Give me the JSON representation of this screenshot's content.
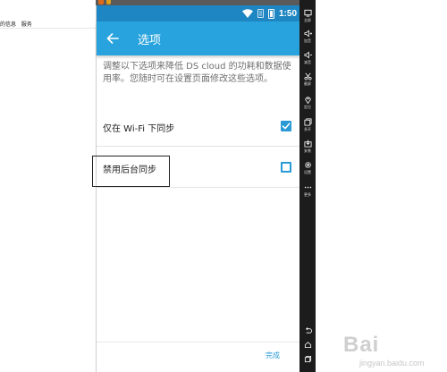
{
  "host": {
    "menu_items": [
      "的信息",
      "服务"
    ]
  },
  "status_bar": {
    "time": "1:50",
    "icons": [
      "wifi-icon",
      "sim-icon",
      "battery-icon"
    ]
  },
  "app_bar": {
    "title": "选项",
    "back_icon": "arrow-left-icon"
  },
  "description": "调整以下选项来降低 DS cloud 的功耗和数据使用率。您随时可在设置页面修改这些选项。",
  "options": [
    {
      "label": "仅在 Wi-Fi 下同步",
      "checked": true
    },
    {
      "label": "禁用后台同步",
      "checked": false
    }
  ],
  "footer": {
    "done_label": "完成"
  },
  "emulator_sidebar": {
    "items": [
      {
        "icon": "screen-icon",
        "label": "全屏"
      },
      {
        "icon": "volume-up-icon",
        "label": "加音"
      },
      {
        "icon": "volume-down-icon",
        "label": "减音"
      },
      {
        "icon": "scissors-icon",
        "label": "截屏"
      },
      {
        "icon": "location-icon",
        "label": "定位"
      },
      {
        "icon": "multi-window-icon",
        "label": "多开"
      },
      {
        "icon": "install-icon",
        "label": "安装"
      },
      {
        "icon": "gear-icon",
        "label": "设置"
      },
      {
        "icon": "more-icon",
        "label": "更多"
      }
    ],
    "nav": [
      "back-icon",
      "home-icon",
      "recent-icon"
    ]
  },
  "watermark": {
    "brand": "Bai",
    "site": "jingyan.baidu.com"
  },
  "colors": {
    "status_bar": "#1e86c2",
    "app_bar": "#28a3dd",
    "accent": "#2a9ad6"
  }
}
